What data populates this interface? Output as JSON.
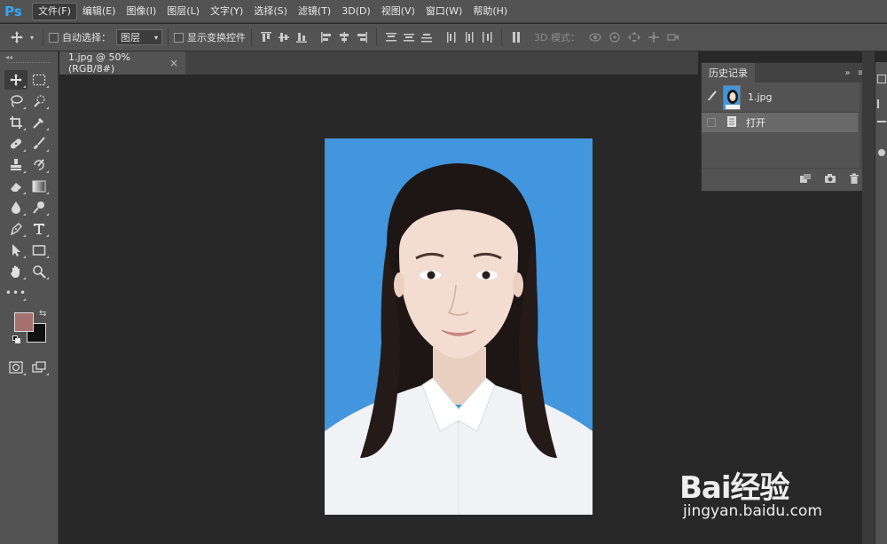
{
  "app": {
    "logo": "Ps"
  },
  "menu": [
    "文件(F)",
    "编辑(E)",
    "图像(I)",
    "图层(L)",
    "文字(Y)",
    "选择(S)",
    "滤镜(T)",
    "3D(D)",
    "视图(V)",
    "窗口(W)",
    "帮助(H)"
  ],
  "options": {
    "auto_select_label": "自动选择：",
    "auto_select_value": "图层",
    "show_transform_label": "显示变换控件",
    "mode_3d_label": "3D 模式："
  },
  "document": {
    "tab_title": "1.jpg @ 50%(RGB/8#)",
    "close_glyph": "×"
  },
  "history": {
    "panel_title": "历史记录",
    "snapshot_name": "1.jpg",
    "items": [
      {
        "label": "打开"
      }
    ]
  },
  "colors": {
    "foreground": "#a5706e",
    "background": "#111111",
    "photo_bg": "#4196dd",
    "ps_blue": "#31a8ff"
  },
  "watermark": {
    "brand": "Bai经验",
    "url": "jingyan.baidu.com"
  }
}
